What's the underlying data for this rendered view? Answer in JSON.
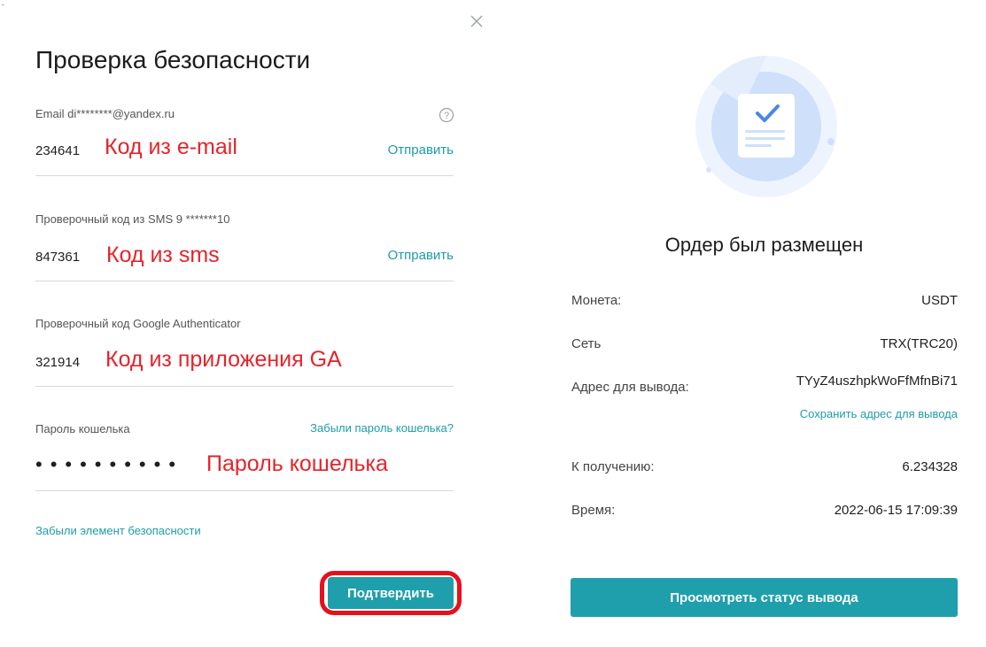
{
  "dialog": {
    "title": "Проверка безопасности",
    "email": {
      "label": "Email di********@yandex.ru",
      "value": "234641",
      "send_label": "Отправить",
      "annotation": "Код из e-mail"
    },
    "sms": {
      "label": "Проверочный код из SMS 9 *******10",
      "value": "847361",
      "send_label": "Отправить",
      "annotation": "Код из sms"
    },
    "ga": {
      "label": "Проверочный код Google Authenticator",
      "value": "321914",
      "annotation": "Код из приложения GA"
    },
    "wallet_password": {
      "label": "Пароль кошелька",
      "forgot_label": "Забыли пароль кошелька?",
      "masked_value": "••••••••••",
      "annotation": "Пароль кошелька"
    },
    "forgot_security_label": "Забыли элемент безопасности",
    "confirm_label": "Подтвердить"
  },
  "order": {
    "title": "Ордер был размещен",
    "rows": [
      {
        "label": "Монета:",
        "value": "USDT"
      },
      {
        "label": "Сеть",
        "value": "TRX(TRC20)"
      },
      {
        "label": "Адрес для вывода:",
        "value": "TYyZ4uszhpkWoFfMfnBi71"
      },
      {
        "label": "К получению:",
        "value": "6.234328"
      },
      {
        "label": "Время:",
        "value": "2022-06-15 17:09:39"
      }
    ],
    "save_address_label": "Сохранить адрес для вывода",
    "status_button_label": "Просмотреть статус вывода"
  },
  "colors": {
    "accent": "#1f9fac",
    "link": "#1e9ca8",
    "annotation_red": "#e5242b",
    "highlight_border": "#e5111d"
  },
  "icons": [
    "close-icon",
    "help-icon",
    "document-check-icon"
  ]
}
